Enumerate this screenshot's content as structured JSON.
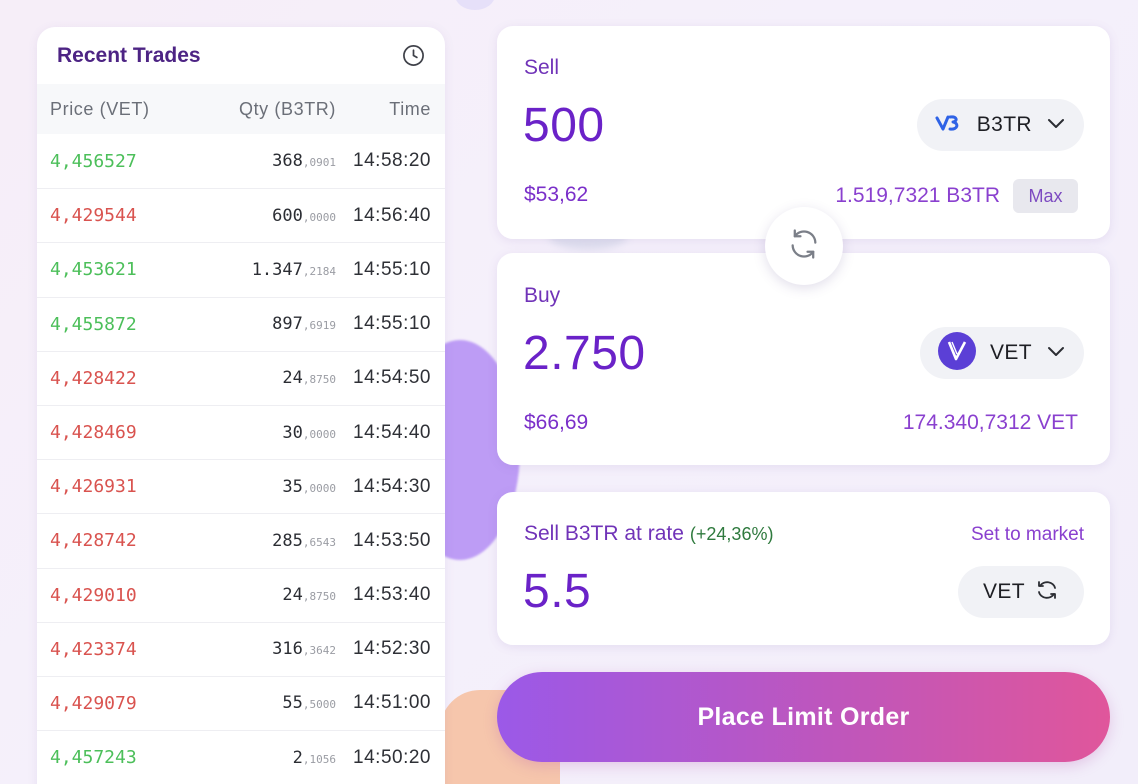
{
  "recent_trades": {
    "title": "Recent Trades",
    "columns": {
      "price": "Price (VET)",
      "qty": "Qty (B3TR)",
      "time": "Time"
    },
    "rows": [
      {
        "price": "4,456527",
        "qty_int": "368",
        "qty_dec": ",0901",
        "time": "14:58:20",
        "side": "buy"
      },
      {
        "price": "4,429544",
        "qty_int": "600",
        "qty_dec": ",0000",
        "time": "14:56:40",
        "side": "sell"
      },
      {
        "price": "4,453621",
        "qty_int": "1.347",
        "qty_dec": ",2184",
        "time": "14:55:10",
        "side": "buy"
      },
      {
        "price": "4,455872",
        "qty_int": "897",
        "qty_dec": ",6919",
        "time": "14:55:10",
        "side": "buy"
      },
      {
        "price": "4,428422",
        "qty_int": "24",
        "qty_dec": ",8750",
        "time": "14:54:50",
        "side": "sell"
      },
      {
        "price": "4,428469",
        "qty_int": "30",
        "qty_dec": ",0000",
        "time": "14:54:40",
        "side": "sell"
      },
      {
        "price": "4,426931",
        "qty_int": "35",
        "qty_dec": ",0000",
        "time": "14:54:30",
        "side": "sell"
      },
      {
        "price": "4,428742",
        "qty_int": "285",
        "qty_dec": ",6543",
        "time": "14:53:50",
        "side": "sell"
      },
      {
        "price": "4,429010",
        "qty_int": "24",
        "qty_dec": ",8750",
        "time": "14:53:40",
        "side": "sell"
      },
      {
        "price": "4,423374",
        "qty_int": "316",
        "qty_dec": ",3642",
        "time": "14:52:30",
        "side": "sell"
      },
      {
        "price": "4,429079",
        "qty_int": "55",
        "qty_dec": ",5000",
        "time": "14:51:00",
        "side": "sell"
      },
      {
        "price": "4,457243",
        "qty_int": "2",
        "qty_dec": ",1056",
        "time": "14:50:20",
        "side": "buy"
      }
    ]
  },
  "sell": {
    "label": "Sell",
    "amount": "500",
    "token": "B3TR",
    "usd_value": "$53,62",
    "balance": "1.519,7321 B3TR",
    "max_label": "Max"
  },
  "buy": {
    "label": "Buy",
    "amount": "2.750",
    "token": "VET",
    "usd_value": "$66,69",
    "balance": "174.340,7312 VET"
  },
  "rate": {
    "label": "Sell B3TR at rate",
    "change": "(+24,36%)",
    "set_market_label": "Set to market",
    "value": "5.5",
    "unit_token": "VET"
  },
  "place_order_label": "Place Limit Order",
  "colors": {
    "accent_purple": "#6a22c8",
    "buy_green": "#4cbf5a",
    "sell_red": "#d9534f",
    "vet_token": "#5b3fd6",
    "b3tr_token": "#2f63e6"
  },
  "icons": {
    "history": "clock-icon",
    "sell_token": "b3tr-logo-icon",
    "buy_token": "vet-logo-icon",
    "dropdown": "chevron-down-icon",
    "swap": "swap-arrows-icon",
    "rate_invert": "invert-rate-icon"
  }
}
